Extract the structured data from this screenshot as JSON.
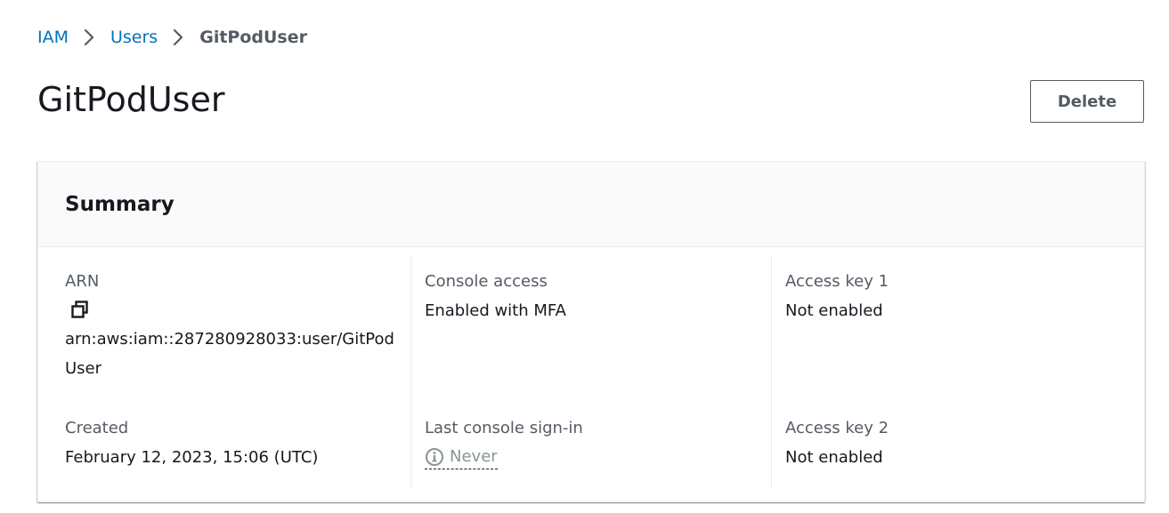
{
  "breadcrumb": {
    "items": [
      {
        "label": "IAM"
      },
      {
        "label": "Users"
      }
    ],
    "current": "GitPodUser"
  },
  "header": {
    "title": "GitPodUser",
    "delete_label": "Delete"
  },
  "summary": {
    "title": "Summary",
    "arn": {
      "label": "ARN",
      "value": "arn:aws:iam::287280928033:user/GitPodUser",
      "icon": "copy-icon"
    },
    "created": {
      "label": "Created",
      "value": "February 12, 2023, 15:06 (UTC)"
    },
    "console_access": {
      "label": "Console access",
      "value": "Enabled with MFA"
    },
    "last_signin": {
      "label": "Last console sign-in",
      "value": "Never",
      "icon": "info-icon"
    },
    "access_key_1": {
      "label": "Access key 1",
      "value": "Not enabled"
    },
    "access_key_2": {
      "label": "Access key 2",
      "value": "Not enabled"
    }
  },
  "colors": {
    "link": "#0073bb",
    "text": "#16191f",
    "label": "#545b64",
    "muted": "#879596",
    "border": "#eaeded",
    "header_bg": "#fafafa"
  }
}
